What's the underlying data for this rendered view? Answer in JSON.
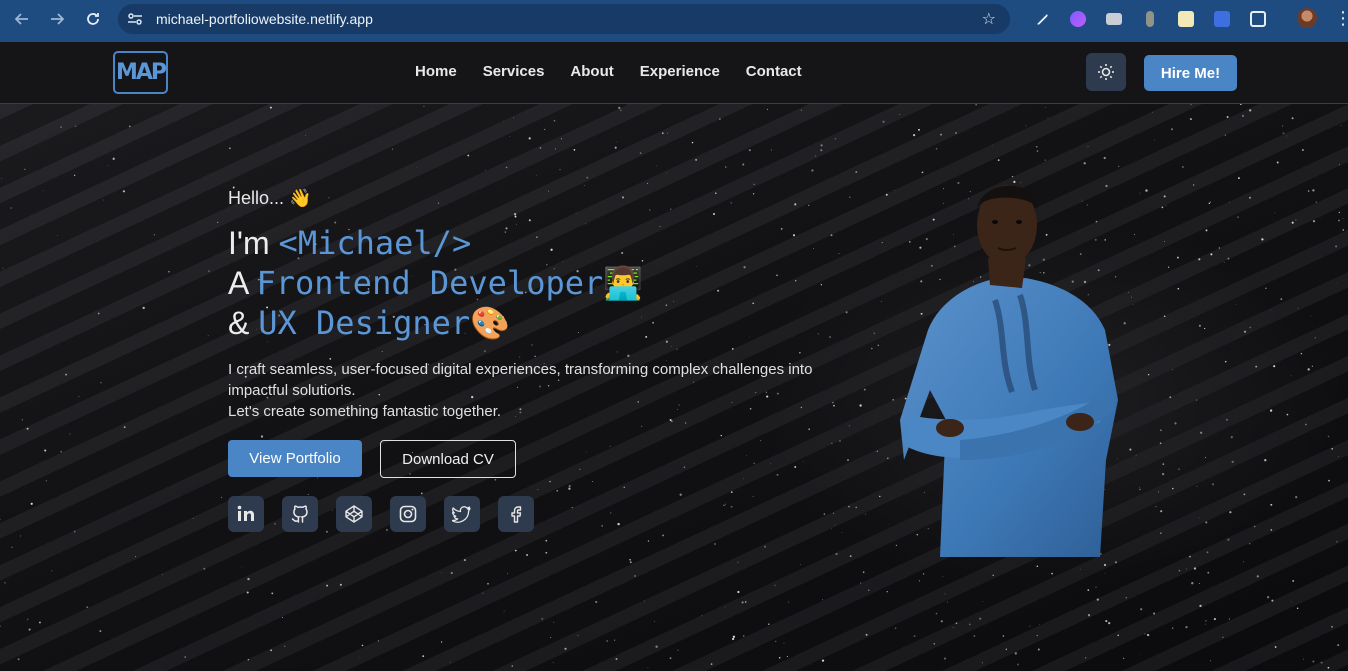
{
  "browser": {
    "url": "michael-portfoliowebsite.netlify.app",
    "back_icon": "arrow-left-icon",
    "forward_icon": "arrow-right-icon",
    "reload_icon": "reload-icon"
  },
  "header": {
    "logo_text": "MAP",
    "nav": [
      "Home",
      "Services",
      "About",
      "Experience",
      "Contact"
    ],
    "hire_label": "Hire Me!"
  },
  "hero": {
    "greeting": "Hello... 👋",
    "line1_prefix": "I'm ",
    "line1_code": "<Michael/>",
    "line2_prefix": "A ",
    "line2_code": "Frontend Developer",
    "line2_emoji": "👨‍💻",
    "line3_prefix": "& ",
    "line3_code": "UX Designer",
    "line3_emoji": "🎨",
    "desc1": "I craft seamless, user-focused digital experiences, transforming complex challenges into impactful solutions.",
    "desc2": "Let's create something fantastic together.",
    "portfolio_label": "View Portfolio",
    "cv_label": "Download CV",
    "socials": [
      "linkedin-icon",
      "github-icon",
      "codepen-icon",
      "instagram-icon",
      "twitter-icon",
      "facebook-icon"
    ]
  },
  "colors": {
    "accent": "#4a85c6",
    "chrome": "#1e4b80",
    "header_bg": "#151518",
    "icon_button_bg": "#2e3a4d"
  }
}
